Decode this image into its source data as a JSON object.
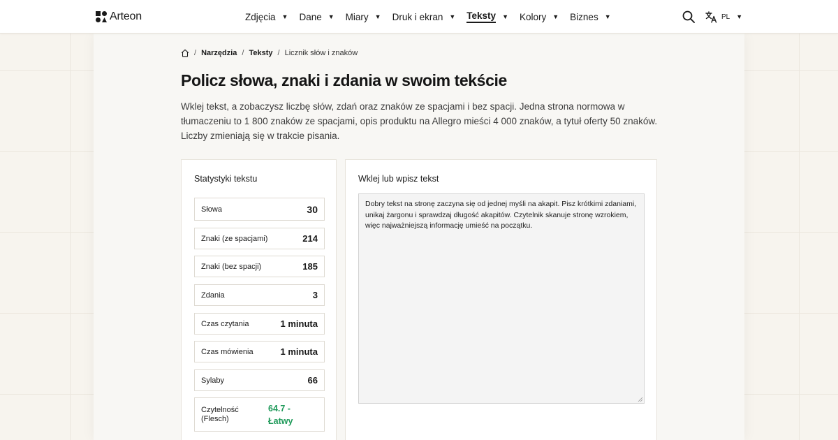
{
  "brand": {
    "name": "Arteon"
  },
  "nav": {
    "items": [
      {
        "label": "Zdjęcia",
        "active": false
      },
      {
        "label": "Dane",
        "active": false
      },
      {
        "label": "Miary",
        "active": false
      },
      {
        "label": "Druk i ekran",
        "active": false
      },
      {
        "label": "Teksty",
        "active": true
      },
      {
        "label": "Kolory",
        "active": false
      },
      {
        "label": "Biznes",
        "active": false
      }
    ],
    "caret": "▼"
  },
  "header": {
    "search_icon": "search-icon",
    "language_icon": "translate-icon",
    "language": "PL",
    "language_caret": "▼"
  },
  "breadcrumb": {
    "home_icon": "home-icon",
    "separator": "/",
    "items": [
      "Narzędzia",
      "Teksty",
      "Licznik słów i znaków"
    ]
  },
  "page": {
    "title": "Policz słowa, znaki i zdania w swoim tekście",
    "intro": "Wklej tekst, a zobaczysz liczbę słów, zdań oraz znaków ze spacjami i bez spacji. Jedna strona normowa w tłumaczeniu to 1 800 znaków ze spacjami, opis produktu na Allegro mieści 4 000 znaków, a tytuł oferty 50 znaków. Liczby zmieniają się w trakcie pisania."
  },
  "stats": {
    "title": "Statystyki tekstu",
    "rows": [
      {
        "label": "Słowa",
        "value": "30"
      },
      {
        "label": "Znaki (ze spacjami)",
        "value": "214"
      },
      {
        "label": "Znaki (bez spacji)",
        "value": "185"
      },
      {
        "label": "Zdania",
        "value": "3"
      },
      {
        "label": "Czas czytania",
        "value": "1 minuta"
      },
      {
        "label": "Czas mówienia",
        "value": "1 minuta"
      },
      {
        "label": "Sylaby",
        "value": "66"
      },
      {
        "label": "Czytelność (Flesch)",
        "value": "64.7 - Łatwy"
      }
    ]
  },
  "editor": {
    "title": "Wklej lub wpisz tekst",
    "text": "Dobry tekst na stronę zaczyna się od jednej myśli na akapit. Pisz krótkimi zdaniami, unikaj żargonu i sprawdzaj długość akapitów. Czytelnik skanuje stronę wzrokiem, więc najważniejszą informację umieść na początku."
  },
  "colors": {
    "accent_green": "#1f9a5a",
    "text_dark": "#1a1a1a",
    "page_bg": "#f7f4ee"
  }
}
